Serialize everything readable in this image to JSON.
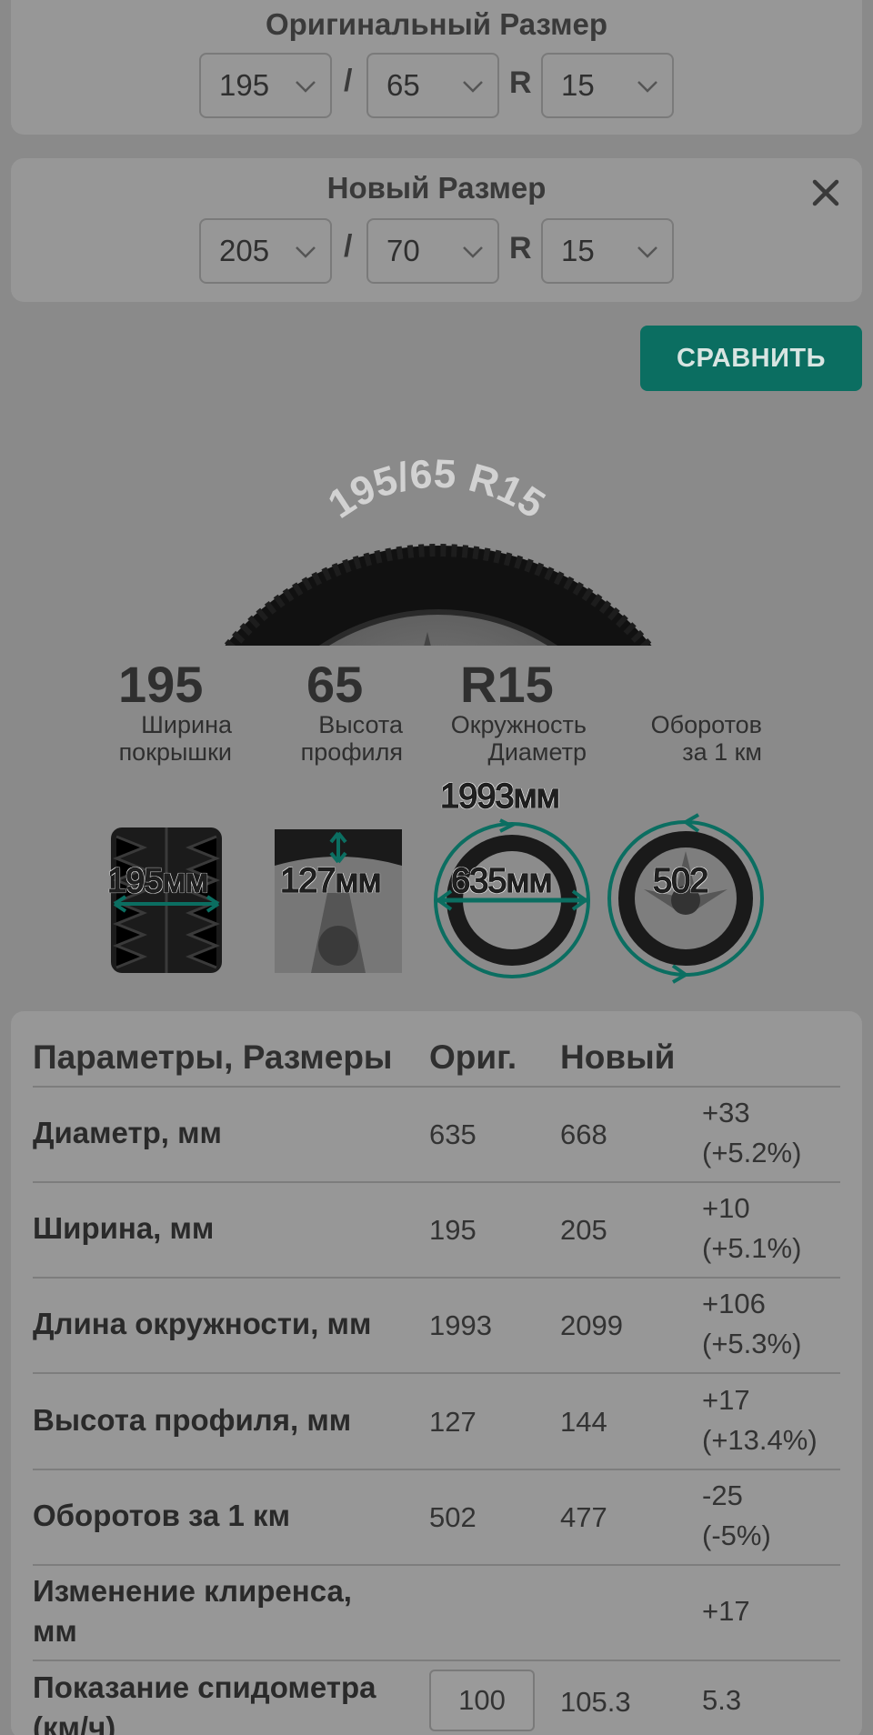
{
  "original": {
    "title": "Оригинальный Размер",
    "width": "195",
    "profile": "65",
    "rim_prefix": "R",
    "rim": "15",
    "separator": "/"
  },
  "new": {
    "title": "Новый Размер",
    "width": "205",
    "profile": "70",
    "rim_prefix": "R",
    "rim": "15",
    "separator": "/"
  },
  "compare_button": "СРАВНИТЬ",
  "hero": {
    "sidewall_text": "195/65  R15"
  },
  "stats": [
    {
      "value": "195",
      "label_1": "Ширина",
      "label_2": "покрышки"
    },
    {
      "value": "65",
      "label_1": "Высота",
      "label_2": "профиля"
    },
    {
      "value": "R15",
      "label_1": "Окружность",
      "label_2": "Диаметр"
    },
    {
      "value": "",
      "label_1": "Оборотов",
      "label_2": "за 1 км"
    }
  ],
  "thumbs": {
    "width": "195мм",
    "profile": "127мм",
    "circumference": "1993мм",
    "diameter": "635мм",
    "revs": "502"
  },
  "table": {
    "headers": [
      "Параметры, Размеры",
      "Ориг.",
      "Новый"
    ],
    "rows": [
      {
        "name": "Диаметр, мм",
        "orig": "635",
        "new": "668",
        "diff_1": "+33",
        "diff_2": "(+5.2%)"
      },
      {
        "name": "Ширина, мм",
        "orig": "195",
        "new": "205",
        "diff_1": "+10",
        "diff_2": "(+5.1%)"
      },
      {
        "name": "Длина окружности, мм",
        "orig": "1993",
        "new": "2099",
        "diff_1": "+106",
        "diff_2": "(+5.3%)"
      },
      {
        "name": "Высота профиля, мм",
        "orig": "127",
        "new": "144",
        "diff_1": "+17",
        "diff_2": "(+13.4%)"
      },
      {
        "name": "Оборотов за 1 км",
        "orig": "502",
        "new": "477",
        "diff_1": "-25",
        "diff_2": "(-5%)"
      },
      {
        "name_1": "Изменение клиренса,",
        "name_2": "мм",
        "diff": "+17"
      },
      {
        "name_1": "Показание спидометра",
        "name_2": "(км/ч)",
        "input": "100",
        "new": "105.3",
        "diff": "5.3"
      }
    ]
  },
  "colors": {
    "accent": "#0b6e61",
    "card": "#979797",
    "background": "#8a8a8a"
  }
}
